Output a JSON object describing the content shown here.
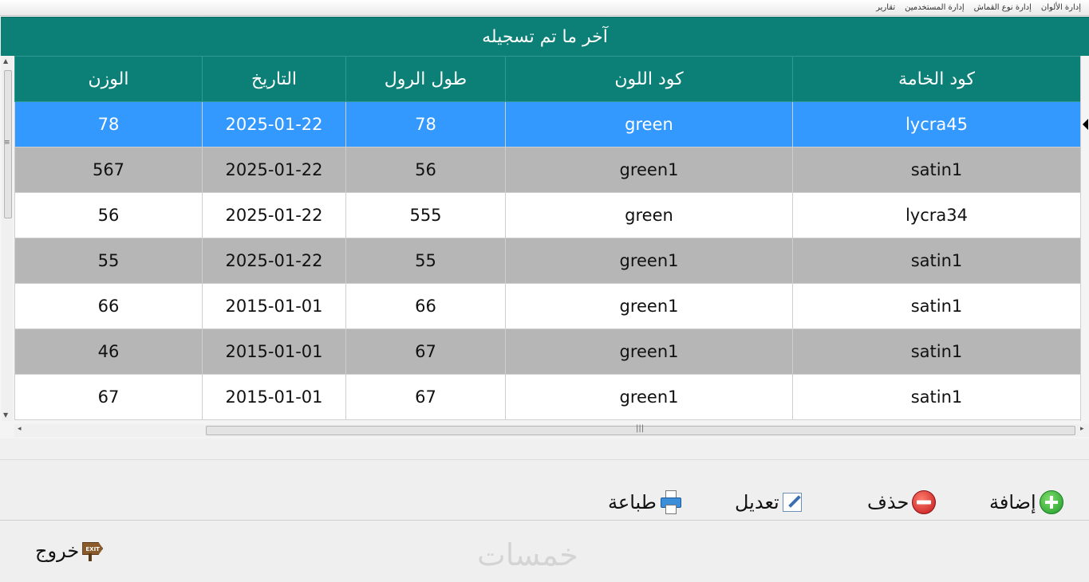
{
  "menu": {
    "items": [
      "إدارة الألوان",
      "إدارة نوع القماش",
      "إدارة المستخدمين",
      "تقارير"
    ]
  },
  "panel": {
    "title": "آخر ما تم تسجيله"
  },
  "table": {
    "columns": [
      "كود الخامة",
      "كود اللون",
      "طول الرول",
      "التاريخ",
      "الوزن"
    ],
    "rows": [
      {
        "material": "lycra45",
        "color": "green",
        "roll_length": "78",
        "date": "2025-01-22",
        "weight": "78",
        "style": "selected"
      },
      {
        "material": "satin1",
        "color": "green1",
        "roll_length": "56",
        "date": "2025-01-22",
        "weight": "567",
        "style": "gray"
      },
      {
        "material": "lycra34",
        "color": "green",
        "roll_length": "555",
        "date": "2025-01-22",
        "weight": "56",
        "style": "white"
      },
      {
        "material": "satin1",
        "color": "green1",
        "roll_length": "55",
        "date": "2025-01-22",
        "weight": "55",
        "style": "gray"
      },
      {
        "material": "satin1",
        "color": "green1",
        "roll_length": "66",
        "date": "2015-01-01",
        "weight": "66",
        "style": "white"
      },
      {
        "material": "satin1",
        "color": "green1",
        "roll_length": "67",
        "date": "2015-01-01",
        "weight": "46",
        "style": "gray"
      },
      {
        "material": "satin1",
        "color": "green1",
        "roll_length": "67",
        "date": "2015-01-01",
        "weight": "67",
        "style": "white"
      }
    ]
  },
  "buttons": {
    "add": "إضافة",
    "delete": "حذف",
    "edit": "تعديل",
    "print": "طباعة",
    "exit": "خروج",
    "exit_sign": "EXIT"
  },
  "watermark": "خمسات",
  "icons": {
    "add": "plus-circle-icon",
    "delete": "minus-circle-icon",
    "edit": "edit-pencil-icon",
    "print": "printer-icon",
    "exit": "exit-sign-icon"
  },
  "colors": {
    "header": "#0c7f76",
    "selected_row": "#3399ff",
    "gray_row": "#b6b6b6",
    "white_row": "#ffffff"
  }
}
